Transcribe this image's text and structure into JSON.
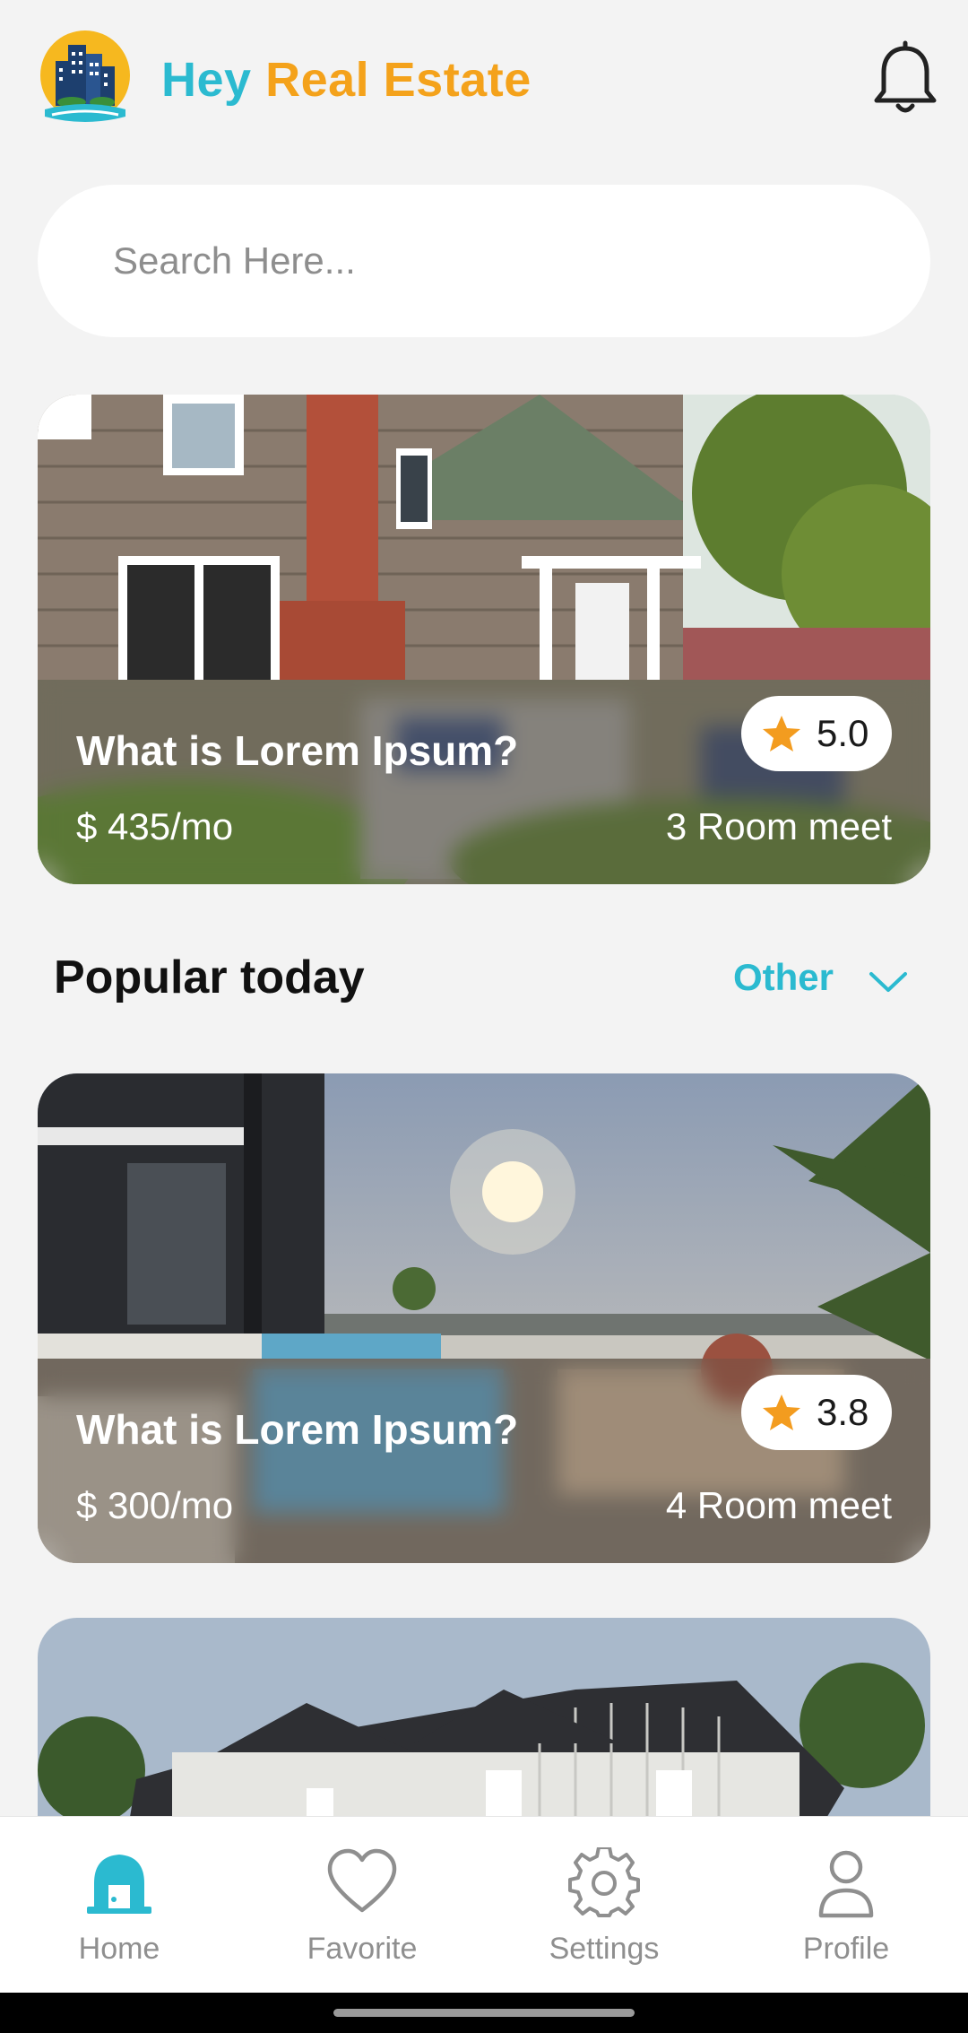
{
  "app": {
    "brand_word1": "Hey",
    "brand_word2": "Real Estate"
  },
  "colors": {
    "accent_teal": "#2bbad0",
    "accent_orange": "#f4a21b",
    "star": "#f39c1f"
  },
  "search": {
    "placeholder": "Search Here..."
  },
  "featured": {
    "title": "What is Lorem Ipsum?",
    "rating": "5.0",
    "price": "$ 435/mo",
    "rooms": "3 Room meet"
  },
  "section": {
    "title": "Popular today",
    "filter_label": "Other"
  },
  "popular": [
    {
      "title": "What is Lorem Ipsum?",
      "rating": "3.8",
      "price": "$ 300/mo",
      "rooms": "4 Room meet"
    }
  ],
  "nav": {
    "items": [
      {
        "label": "Home",
        "icon": "home-icon",
        "active": true
      },
      {
        "label": "Favorite",
        "icon": "heart-icon",
        "active": false
      },
      {
        "label": "Settings",
        "icon": "gear-icon",
        "active": false
      },
      {
        "label": "Profile",
        "icon": "person-icon",
        "active": false
      }
    ]
  }
}
